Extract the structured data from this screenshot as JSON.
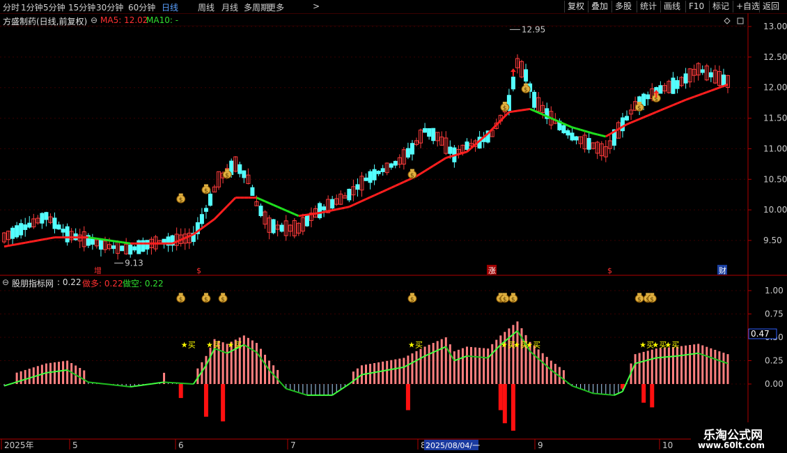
{
  "toolbar": {
    "periods": [
      "分时",
      "1分钟",
      "5分钟",
      "15分钟",
      "30分钟",
      "60分钟",
      "日线",
      "周线",
      "月线",
      "多周期",
      "更多"
    ],
    "active": "日线",
    "more_arrow": ">",
    "buttons": [
      "复权",
      "叠加",
      "多股",
      "统计",
      "画线",
      "F10",
      "标记",
      "+自选",
      "返回"
    ]
  },
  "main_header": {
    "title": "方盛制药(日线,前复权)",
    "ma5_label": "MA5: 12.02",
    "ma10_label": "MA10: -"
  },
  "indicator_header": {
    "name": "股朋指标网",
    "value": ": 0.22",
    "long_label": "做多: 0.22",
    "short_label": "做空: 0.22"
  },
  "markers": {
    "high_label": "12.95",
    "low_label": "9.13",
    "event_labels": [
      {
        "text": "增",
        "color": "#ff3030",
        "bg": "#000"
      },
      {
        "text": "$",
        "color": "#ff3030",
        "bg": "#000"
      },
      {
        "text": "涨",
        "color": "#ffffff",
        "bg": "#a00000"
      },
      {
        "text": "$",
        "color": "#ff3030",
        "bg": "#000"
      },
      {
        "text": "财",
        "color": "#ffffff",
        "bg": "#1a3fa0"
      }
    ],
    "buy_label": "买",
    "cursor_value": "0.47"
  },
  "xaxis": {
    "labels": [
      "2025年",
      "5",
      "6",
      "7",
      "8",
      "9",
      "10"
    ],
    "cursor_date": "2025/08/04/一"
  },
  "watermark": {
    "line1": "乐淘公式网",
    "line2": "www.60lt.com"
  },
  "colors": {
    "up": "#ff3c3c",
    "down": "#54ffff",
    "ma_up": "#ff1e1e",
    "ma_down": "#1ee01e",
    "axis": "#b00000",
    "buy_star": "#ffff00"
  },
  "chart_data": [
    {
      "type": "candlestick",
      "title": "方盛制药(日线,前复权)",
      "y_ticks": [
        "13.00",
        "12.50",
        "12.00",
        "11.50",
        "11.00",
        "10.50",
        "10.00",
        "9.50"
      ],
      "ylim": [
        9.1,
        13.1
      ],
      "high": 12.95,
      "low": 9.13,
      "x_ticks": [
        "2025年",
        "5",
        "6",
        "7",
        "8",
        "9",
        "10"
      ],
      "ma_series": [
        {
          "name": "MA5",
          "last": 12.02
        },
        {
          "name": "MA10",
          "last": null
        }
      ],
      "ma_line_waypoints": [
        [
          0,
          9.4
        ],
        [
          12,
          9.55
        ],
        [
          20,
          9.55
        ],
        [
          30,
          9.45
        ],
        [
          40,
          9.45
        ],
        [
          45,
          9.6
        ],
        [
          50,
          9.85
        ],
        [
          55,
          10.2
        ],
        [
          60,
          10.2
        ],
        [
          65,
          10.05
        ],
        [
          70,
          9.9
        ],
        [
          75,
          9.95
        ],
        [
          82,
          10.05
        ],
        [
          90,
          10.3
        ],
        [
          98,
          10.55
        ],
        [
          105,
          10.85
        ],
        [
          110,
          10.95
        ],
        [
          115,
          11.25
        ],
        [
          120,
          11.6
        ],
        [
          125,
          11.65
        ],
        [
          130,
          11.5
        ],
        [
          135,
          11.35
        ],
        [
          140,
          11.25
        ],
        [
          143,
          11.2
        ],
        [
          148,
          11.4
        ],
        [
          155,
          11.6
        ],
        [
          162,
          11.8
        ],
        [
          168,
          11.95
        ],
        [
          172,
          12.05
        ]
      ]
    },
    {
      "type": "bar",
      "title": "股朋指标网",
      "y_ticks": [
        "1.00",
        "0.75",
        "0.50",
        "0.25",
        "0.00"
      ],
      "ylim": [
        -0.45,
        1.12
      ],
      "series": [
        {
          "name": "做多",
          "last": 0.22
        },
        {
          "name": "做空",
          "last": 0.22
        }
      ],
      "indicator_line_waypoints": [
        [
          0,
          -0.02
        ],
        [
          10,
          0.12
        ],
        [
          15,
          0.15
        ],
        [
          20,
          0.02
        ],
        [
          30,
          -0.03
        ],
        [
          38,
          0.02
        ],
        [
          45,
          0.0
        ],
        [
          48,
          0.2
        ],
        [
          50,
          0.38
        ],
        [
          53,
          0.33
        ],
        [
          57,
          0.42
        ],
        [
          60,
          0.34
        ],
        [
          63,
          0.15
        ],
        [
          67,
          -0.05
        ],
        [
          72,
          -0.12
        ],
        [
          78,
          -0.12
        ],
        [
          82,
          0.0
        ],
        [
          85,
          0.1
        ],
        [
          95,
          0.18
        ],
        [
          100,
          0.3
        ],
        [
          105,
          0.4
        ],
        [
          107,
          0.25
        ],
        [
          110,
          0.3
        ],
        [
          115,
          0.28
        ],
        [
          118,
          0.42
        ],
        [
          122,
          0.57
        ],
        [
          125,
          0.35
        ],
        [
          130,
          0.15
        ],
        [
          135,
          -0.02
        ],
        [
          140,
          -0.1
        ],
        [
          145,
          -0.12
        ],
        [
          147,
          -0.08
        ],
        [
          150,
          0.22
        ],
        [
          155,
          0.28
        ],
        [
          160,
          0.3
        ],
        [
          165,
          0.33
        ],
        [
          170,
          0.25
        ],
        [
          172,
          0.22
        ]
      ]
    }
  ]
}
